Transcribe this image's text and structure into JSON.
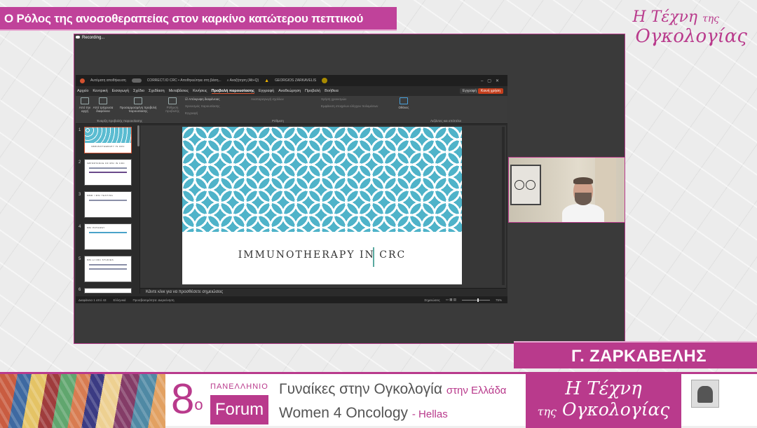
{
  "banner": {
    "title": "Ο Ρόλος της ανοσοθεραπείας στον καρκίνο κατώτερου πεπτικού"
  },
  "top_logo": {
    "prefix": "Η",
    "word1": "Τέχνη",
    "small": "της",
    "word2": "Ογκολογίας"
  },
  "recording": {
    "label": "Recording..."
  },
  "ppt": {
    "titlebar": {
      "autosave": "Αυτόματη αποθήκευση",
      "filename": "CORRECT.IO CRC • Αποθηκεύτηκε στη βάση...",
      "search": "Αναζήτηση (Alt+Q)",
      "user": "GEORGIOS ZARKAVELIS"
    },
    "menu": [
      "Αρχείο",
      "Κεντρική",
      "Εισαγωγή",
      "Σχέδιο",
      "Σχεδίαση",
      "Μεταβάσεις",
      "Κινήσεις",
      "Προβολή παρουσίασης",
      "Εγγραφή",
      "Αναθεώρηση",
      "Προβολή",
      "Βοήθεια"
    ],
    "record_btn": "Εγγραφή",
    "share_btn": "Κοινή χρήση",
    "ribbon": {
      "from_start": "Από την αρχή",
      "from_current": "Από τρέχουσα διαφάνεια",
      "custom": "Προσαρμοσμένη προβολή παρουσίασης",
      "setup": "Ρύθμιση προβολής",
      "hide_slide": "Απόκρυψη διαφάνειας",
      "rehearse": "Χρονισμός παρουσίασης",
      "record": "Εγγραφή",
      "narrations": "Αναπαραγωγή σχολίων",
      "use_timings": "Χρήση χρονισμών",
      "show_media": "Εμφάνιση στοιχείων ελέγχου πολυμέσων",
      "monitor": "Οθόνες",
      "group1": "Έναρξη προβολής παρουσίασης",
      "group2": "Ρύθμιση",
      "group3": "Λεζάντες και υπότιτλοι"
    },
    "thumbnails": [
      {
        "n": "1",
        "title": "IMMUNOTHERAPY IN CRC"
      },
      {
        "n": "2",
        "title": "IMPORTANCE OF MSI IN CRC"
      },
      {
        "n": "3",
        "title": "MMR / MSI TESTING"
      },
      {
        "n": "4",
        "title": "MSI PATHWAY"
      },
      {
        "n": "5",
        "title": "MSI-H CRC STUDIES"
      },
      {
        "n": "6",
        "title": ""
      }
    ],
    "slide": {
      "title": "IMMUNOTHERAPY IN CRC"
    },
    "notes_placeholder": "Κάντε κλικ για να προσθέσετε σημειώσεις",
    "status": {
      "slide_info": "Διαφάνεια 1 από 43",
      "language": "Ελληνικά",
      "accessibility": "Προσβασιμότητα: Διερεύνηση",
      "notes": "Σημειώσεις",
      "zoom": "75%"
    }
  },
  "speaker": {
    "name": "Γ. ΖΑΡΚΑΒΕΛΗΣ"
  },
  "footer": {
    "number": "8",
    "sup": "ο",
    "panellinio": "ΠΑΝΕΛΛΗΝΙΟ",
    "forum": "Forum",
    "line1_main": "Γυναίκες στην Ογκολογία",
    "line1_pink": "στην Ελλάδα",
    "line2_main": "Women 4 Oncology",
    "line2_pink": "- Hellas",
    "logo_prefix": "Η",
    "logo_word1": "Τέχνη",
    "logo_small": "της",
    "logo_word2": "Ογκολογίας"
  }
}
